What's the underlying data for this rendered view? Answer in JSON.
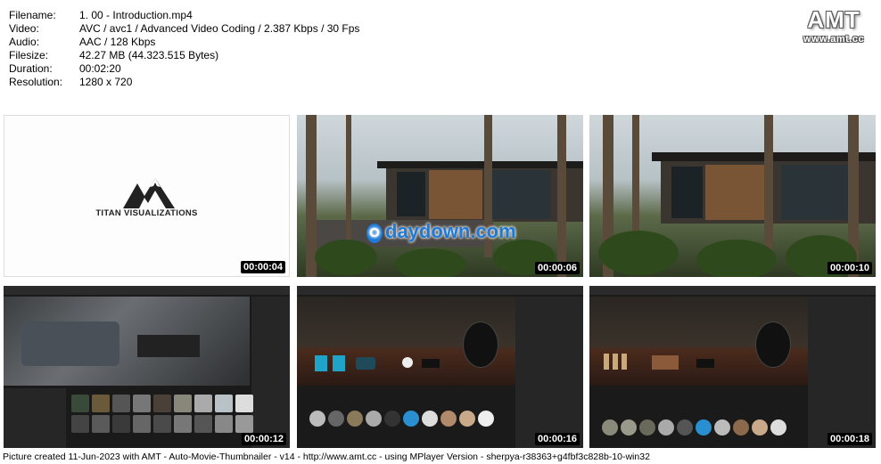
{
  "info": {
    "rows": [
      {
        "key": "Filename:",
        "value": "1. 00 - Introduction.mp4"
      },
      {
        "key": "Video:",
        "value": "AVC / avc1 / Advanced Video Coding / 2.387 Kbps / 30 Fps"
      },
      {
        "key": "Audio:",
        "value": "AAC / 128 Kbps"
      },
      {
        "key": "Filesize:",
        "value": "42.27 MB (44.323.515 Bytes)"
      },
      {
        "key": "Duration:",
        "value": "00:02:20"
      },
      {
        "key": "Resolution:",
        "value": "1280 x 720"
      }
    ]
  },
  "logo": {
    "title": "AMT",
    "url": "www.amt.cc"
  },
  "thumbs": [
    {
      "timestamp": "00:00:04",
      "brand": "TITAN VISUALIZATIONS"
    },
    {
      "timestamp": "00:00:06",
      "watermark_letter": "O",
      "watermark": "daydown.com"
    },
    {
      "timestamp": "00:00:10"
    },
    {
      "timestamp": "00:00:12"
    },
    {
      "timestamp": "00:00:16"
    },
    {
      "timestamp": "00:00:18"
    }
  ],
  "footer": "Picture created 11-Jun-2023 with AMT - Auto-Movie-Thumbnailer - v14 - http://www.amt.cc - using MPlayer Version - sherpya-r38363+g4fbf3c828b-10-win32"
}
